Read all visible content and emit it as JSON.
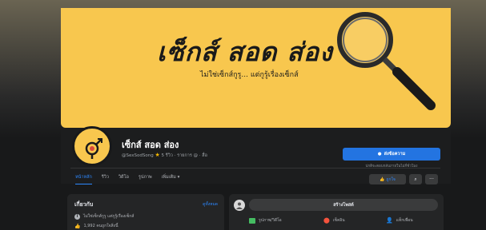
{
  "cover": {
    "title": "เซ็กส์ สอด ส่อง",
    "subtitle": "ไม่ใช่เซ็กส์กูรู... แต่กูรู้เรื่องเซ็กส์"
  },
  "profile": {
    "name": "เซ็กส์ สอด ส่อง",
    "handle": "@SexSodSong",
    "rating": "5 รีวิว",
    "meta_tail": "· รายการ @ · สื่อ",
    "send_message_label": "ส่งข้อความ",
    "reply_note": "ปกติจะตอบกลับภายในไม่กี่ชั่วโมง"
  },
  "tabs": [
    {
      "label": "หน้าหลัก",
      "active": true
    },
    {
      "label": "รีวิว",
      "active": false
    },
    {
      "label": "วิดีโอ",
      "active": false
    },
    {
      "label": "รูปภาพ",
      "active": false
    },
    {
      "label": "เพิ่มเติม ▾",
      "active": false
    }
  ],
  "actions": {
    "like_label": "ถูกใจ",
    "search_icon": "search-icon",
    "more_label": "···"
  },
  "intro": {
    "title": "เกี่ยวกับ",
    "edit_label": "ดูทั้งหมด",
    "rows": [
      {
        "icon": "info-icon",
        "text": "ไม่ใช่เซ็กส์กูรู แต่กูรู้เรื่องเซ็กส์"
      },
      {
        "icon": "like-icon",
        "text": "1,992 คนถูกใจสิ่งนี้"
      }
    ]
  },
  "composer": {
    "create_post_label": "สร้างโพสต์",
    "actions": [
      {
        "icon": "photo-icon",
        "label": "รูปภาพ/วิดีโอ",
        "color": "#45bd62"
      },
      {
        "icon": "location-icon",
        "label": "เช็คอิน",
        "color": "#f5533d"
      },
      {
        "icon": "tag-people-icon",
        "label": "แท็กเพื่อน",
        "color": "#1877f2"
      }
    ]
  },
  "colors": {
    "cover_bg": "#f8c74e",
    "accent": "#2374e1",
    "card_bg": "#242526"
  }
}
